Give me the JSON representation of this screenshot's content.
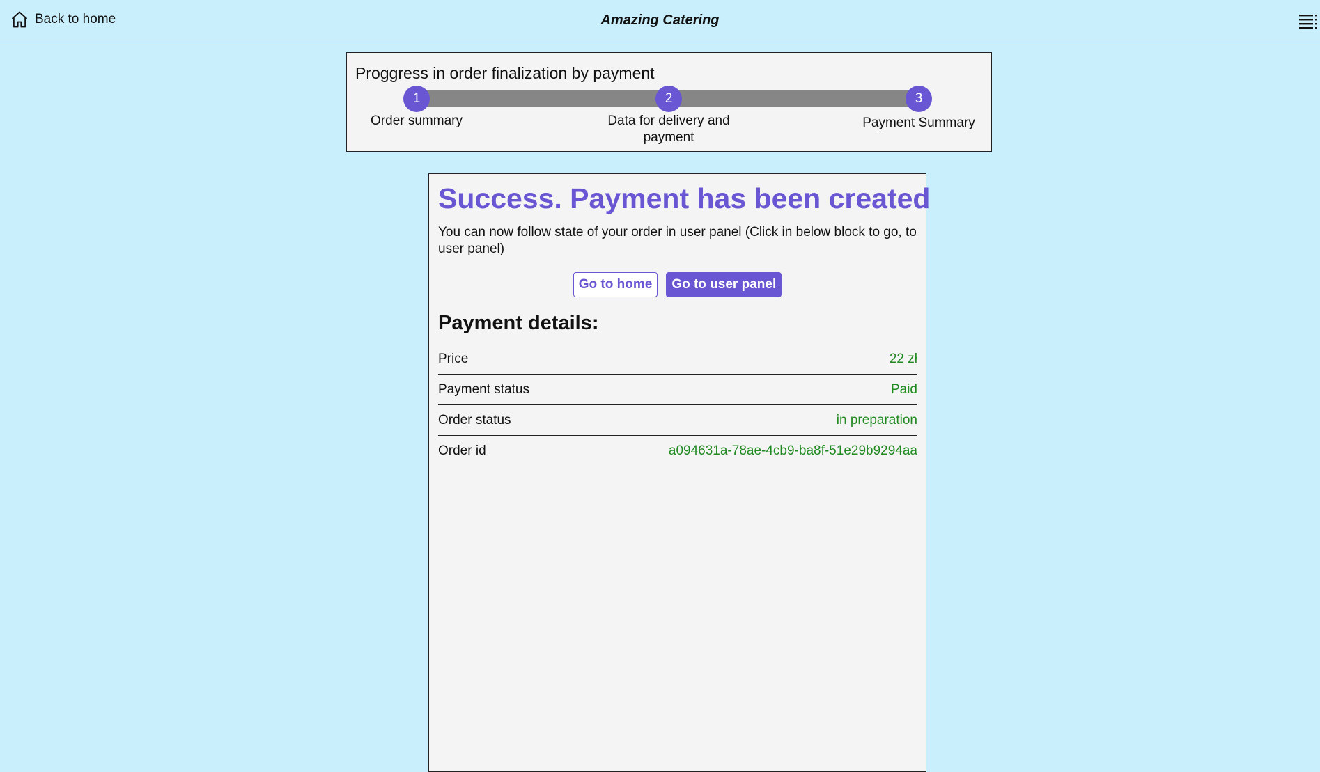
{
  "header": {
    "back_label": "Back to home",
    "brand": "Amazing Catering",
    "home_icon": "home-icon",
    "menu_icon": "hamburger-menu-icon"
  },
  "progress": {
    "title": "Proggress in order finalization by payment",
    "steps": [
      {
        "number": "1",
        "label": "Order summary"
      },
      {
        "number": "2",
        "label": "Data for delivery and payment"
      },
      {
        "number": "3",
        "label": "Payment Summary"
      }
    ]
  },
  "result": {
    "title": "Success. Payment has been created",
    "message": "You can now follow state of your order in user panel (Click in below block to go, to user panel)",
    "go_home_label": "Go to home",
    "go_user_panel_label": "Go to user panel"
  },
  "payment_details": {
    "title": "Payment details:",
    "rows": [
      {
        "label": "Price",
        "value": "22 zł"
      },
      {
        "label": "Payment status",
        "value": "Paid"
      },
      {
        "label": "Order status",
        "value": "in preparation"
      },
      {
        "label": "Order id",
        "value": "a094631a-78ae-4cb9-ba8f-51e29b9294aa"
      }
    ]
  },
  "colors": {
    "background": "#c9eefc",
    "accent": "#6856d3",
    "value_green": "#1f8a1f",
    "track_gray": "#868686"
  }
}
